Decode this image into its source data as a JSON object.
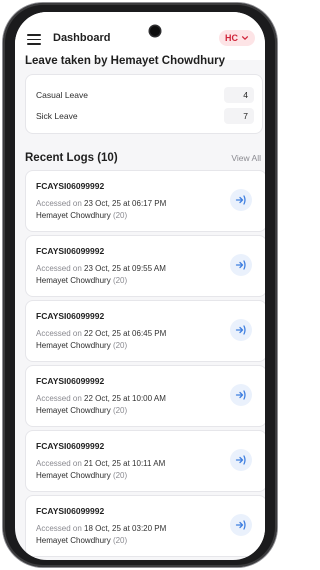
{
  "header": {
    "title": "Dashboard",
    "user_chip": "HC",
    "menu_icon": "hamburger-menu-icon",
    "chip_icon": "chevron-down-icon",
    "accent_color": "#d0253a"
  },
  "leave": {
    "heading": "Leave taken by Hemayet Chowdhury",
    "items": [
      {
        "label": "Casual Leave",
        "value": "4"
      },
      {
        "label": "Sick Leave",
        "value": "7"
      }
    ]
  },
  "logs": {
    "heading": "Recent Logs (10)",
    "view_all": "View All",
    "accessed_prefix": "Accessed on ",
    "arrow_icon": "login-arrow-icon",
    "items": [
      {
        "code": "FCAYSI06099992",
        "date": "23 Oct, 25 at 06:17 PM",
        "user": "Hemayet Chowdhury",
        "age": "(20)"
      },
      {
        "code": "FCAYSI06099992",
        "date": "23 Oct, 25 at 09:55 AM",
        "user": "Hemayet Chowdhury",
        "age": "(20)"
      },
      {
        "code": "FCAYSI06099992",
        "date": "22 Oct, 25 at 06:45 PM",
        "user": "Hemayet Chowdhury",
        "age": "(20)"
      },
      {
        "code": "FCAYSI06099992",
        "date": "22 Oct, 25 at 10:00 AM",
        "user": "Hemayet Chowdhury",
        "age": "(20)"
      },
      {
        "code": "FCAYSI06099992",
        "date": "21 Oct, 25 at 10:11 AM",
        "user": "Hemayet Chowdhury",
        "age": "(20)"
      },
      {
        "code": "FCAYSI06099992",
        "date": "18 Oct, 25 at 03:20 PM",
        "user": "Hemayet Chowdhury",
        "age": "(20)"
      }
    ]
  }
}
